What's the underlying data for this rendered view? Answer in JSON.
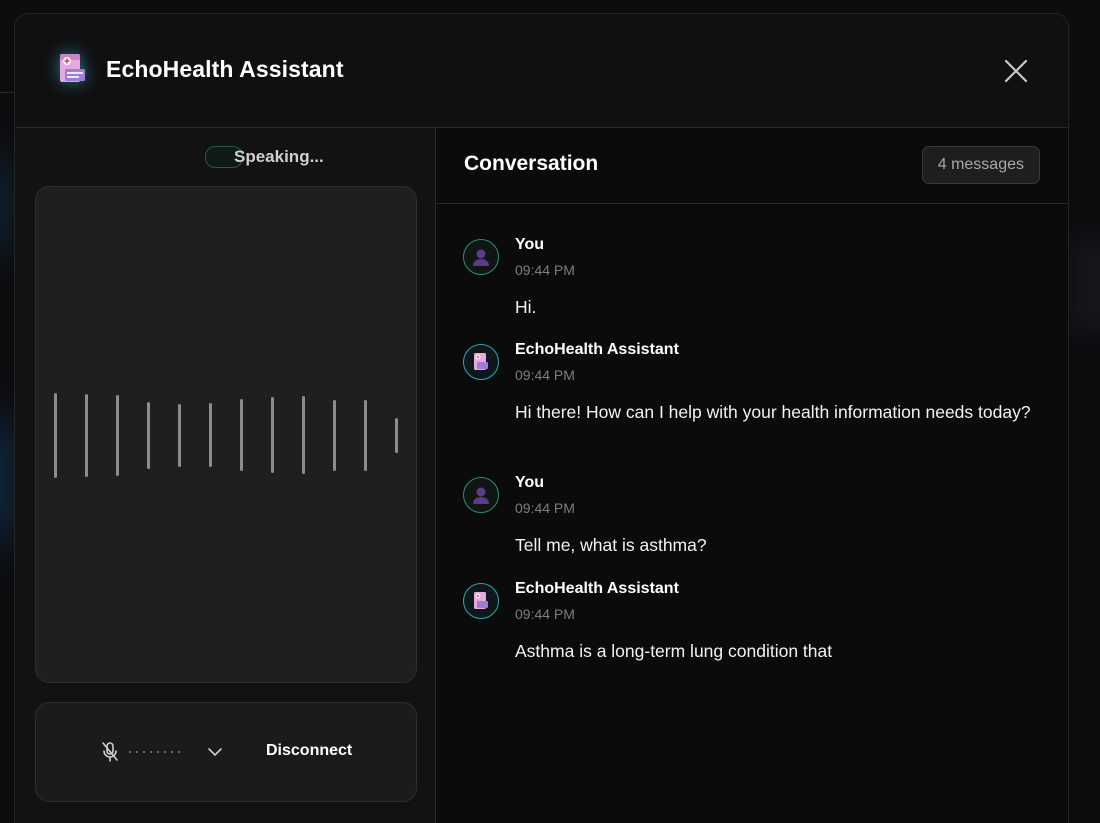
{
  "header": {
    "app_title": "EchoHealth Assistant",
    "logo_icon": "medical-records-icon",
    "close_icon": "close-icon"
  },
  "status": {
    "text": "Speaking..."
  },
  "visualizer": {
    "bar_levels": [
      0.74,
      0.72,
      0.7,
      0.58,
      0.55,
      0.56,
      0.63,
      0.66,
      0.68,
      0.62,
      0.62,
      0.3
    ]
  },
  "controls": {
    "mic_icon": "microphone-muted-icon",
    "dropdown_icon": "chevron-down-icon",
    "disconnect_label": "Disconnect"
  },
  "conversation": {
    "title": "Conversation",
    "count_label": "4 messages",
    "messages": [
      {
        "role": "user",
        "sender": "You",
        "time": "09:44 PM",
        "text": "Hi."
      },
      {
        "role": "assistant",
        "sender": "EchoHealth Assistant",
        "time": "09:44 PM",
        "text": "Hi there! How can I help with your health information needs today?"
      },
      {
        "role": "user",
        "sender": "You",
        "time": "09:44 PM",
        "text": "Tell me, what is asthma?"
      },
      {
        "role": "assistant",
        "sender": "EchoHealth Assistant",
        "time": "09:44 PM",
        "text": "Asthma is a long-term lung condition that"
      }
    ]
  },
  "colors": {
    "accent_teal": "#2aa7b9",
    "accent_green": "#2f8f68",
    "logo_pink": "#e8a8e0"
  }
}
